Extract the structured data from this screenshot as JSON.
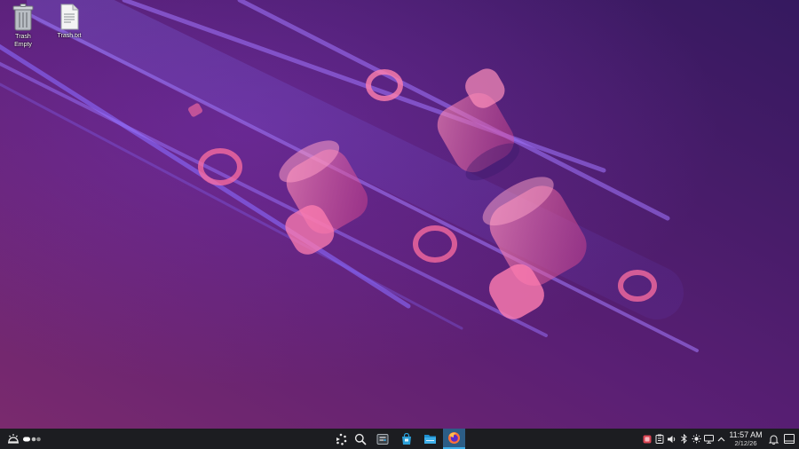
{
  "desktop": {
    "icons": [
      {
        "name": "trash-icon",
        "label_line1": "Trash",
        "label_line2": "Empty"
      },
      {
        "name": "text-file-icon",
        "label_line1": "Trash.txt"
      }
    ],
    "wallpaper": {
      "colors": {
        "top_right": "#3a1a6b",
        "mid": "#5a1f74",
        "bottom_left": "#7a2a6e",
        "accent_pink": "#ff6fa0",
        "accent_blue": "#8a7bff"
      }
    }
  },
  "taskbar": {
    "background": "#1c1d21",
    "accent": "#3daee9",
    "left": [
      {
        "name": "application-launcher-icon"
      },
      {
        "name": "virtual-desktop-pager"
      }
    ],
    "center": [
      {
        "name": "overview-icon"
      },
      {
        "name": "search-icon"
      },
      {
        "name": "system-settings-icon"
      },
      {
        "name": "discover-store-icon"
      },
      {
        "name": "file-manager-icon"
      },
      {
        "name": "firefox-icon",
        "active": true
      }
    ],
    "tray": [
      {
        "name": "software-updates-icon"
      },
      {
        "name": "clipboard-icon"
      },
      {
        "name": "volume-icon"
      },
      {
        "name": "bluetooth-icon"
      },
      {
        "name": "brightness-icon"
      },
      {
        "name": "display-icon"
      },
      {
        "name": "tray-expand-chevron-icon"
      }
    ],
    "clock": {
      "time": "11:57 AM",
      "date": "2/12/26"
    },
    "right": [
      {
        "name": "notifications-bell-icon"
      },
      {
        "name": "show-desktop-icon"
      }
    ]
  }
}
